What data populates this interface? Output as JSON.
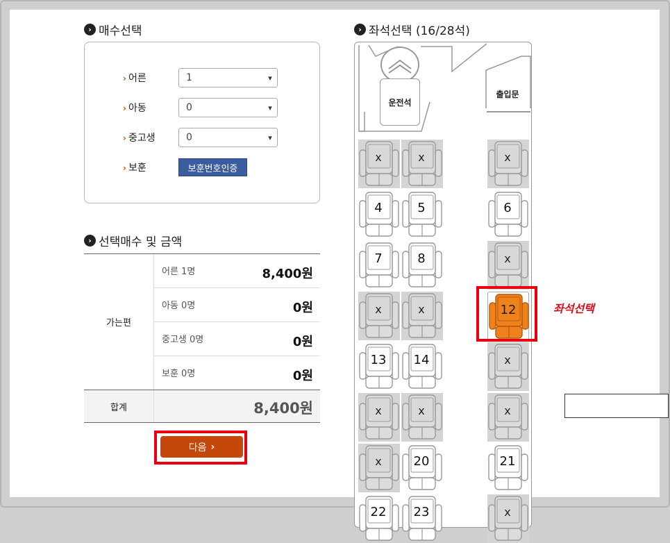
{
  "quantity": {
    "title": "매수선택",
    "rows": [
      {
        "label": "어른",
        "value": "1"
      },
      {
        "label": "아동",
        "value": "0"
      },
      {
        "label": "중고생",
        "value": "0"
      },
      {
        "label": "보훈",
        "button": "보훈번호인증"
      }
    ]
  },
  "summary": {
    "title": "선택매수 및 금액",
    "trip_label": "가는편",
    "lines": [
      {
        "label": "어른 1명",
        "amount": "8,400원"
      },
      {
        "label": "아동 0명",
        "amount": "0원"
      },
      {
        "label": "중고생 0명",
        "amount": "0원"
      },
      {
        "label": "보훈 0명",
        "amount": "0원"
      }
    ],
    "total_label": "합계",
    "total_amount": "8,400원"
  },
  "next_button": "다음",
  "seat_select": {
    "title": "좌석선택 (16/28석)",
    "driver_label": "운전석",
    "door_label": "출입문",
    "note": "좌석선택",
    "seats": [
      {
        "label": "x",
        "state": "taken"
      },
      {
        "label": "x",
        "state": "taken"
      },
      {
        "label": "x",
        "state": "taken"
      },
      {
        "label": "4",
        "state": "open"
      },
      {
        "label": "5",
        "state": "open"
      },
      {
        "label": "6",
        "state": "open"
      },
      {
        "label": "7",
        "state": "open"
      },
      {
        "label": "8",
        "state": "open"
      },
      {
        "label": "x",
        "state": "taken"
      },
      {
        "label": "x",
        "state": "taken"
      },
      {
        "label": "x",
        "state": "taken"
      },
      {
        "label": "12",
        "state": "selected"
      },
      {
        "label": "13",
        "state": "open"
      },
      {
        "label": "14",
        "state": "open"
      },
      {
        "label": "x",
        "state": "taken"
      },
      {
        "label": "x",
        "state": "taken"
      },
      {
        "label": "x",
        "state": "taken"
      },
      {
        "label": "x",
        "state": "taken"
      },
      {
        "label": "x",
        "state": "taken"
      },
      {
        "label": "20",
        "state": "open"
      },
      {
        "label": "21",
        "state": "open"
      },
      {
        "label": "22",
        "state": "open"
      },
      {
        "label": "23",
        "state": "open"
      },
      {
        "label": "x",
        "state": "taken"
      }
    ]
  },
  "colors": {
    "accent": "#c5480b",
    "highlight": "#e8000f",
    "selected_seat": "#f0821e",
    "taken_seat": "#d4d4d4",
    "cert_button": "#3a5d9f"
  }
}
